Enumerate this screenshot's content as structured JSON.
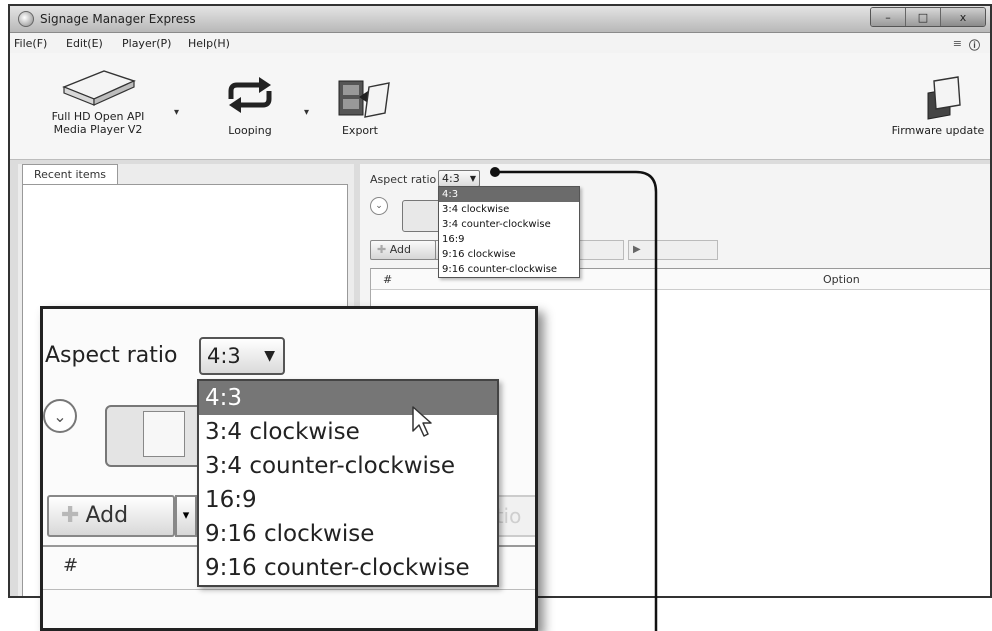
{
  "window": {
    "title": "Signage Manager Express",
    "buttons": {
      "minimize": "–",
      "maximize": "□",
      "close": "x"
    }
  },
  "menu": {
    "items": [
      "File(F)",
      "Edit(E)",
      "Player(P)",
      "Help(H)"
    ],
    "right_icons": [
      "menu-icon",
      "info-icon"
    ]
  },
  "toolbar": {
    "player_label_1": "Full HD Open API",
    "player_label_2": "Media Player V2",
    "looping_label": "Looping",
    "export_label": "Export",
    "firmware_label": "Firmware update"
  },
  "left_pane": {
    "tab_label": "Recent items"
  },
  "right_pane": {
    "aspect_label": "Aspect ratio",
    "aspect_value": "4:3",
    "add_label": "Add",
    "col_hash": "#",
    "col_option": "Option",
    "aspect_options": [
      "4:3",
      "3:4 clockwise",
      "3:4 counter-clockwise",
      "16:9",
      "9:16 clockwise",
      "9:16 counter-clockwise"
    ],
    "selected_index": 0
  },
  "callout": {
    "aspect_label": "Aspect ratio",
    "aspect_value": "4:3",
    "add_label": "Add",
    "faded_label": "ptio",
    "col_hash": "#"
  },
  "colors": {
    "highlight": "#6b6b6b",
    "frame": "#222222"
  }
}
